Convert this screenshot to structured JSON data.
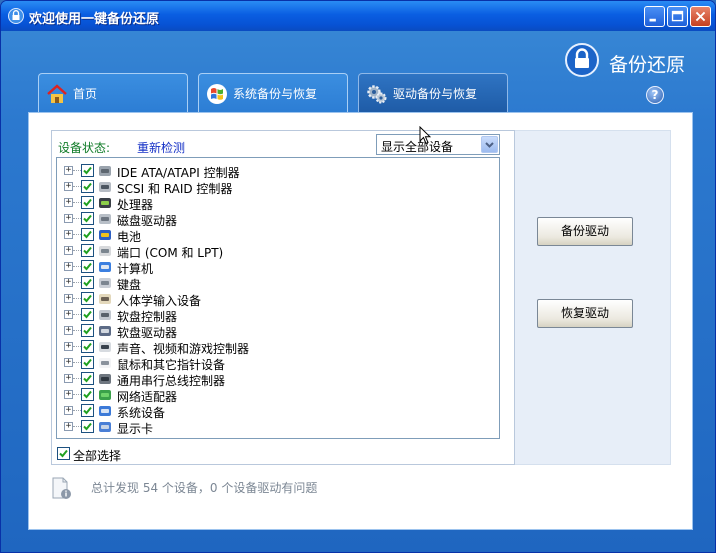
{
  "window": {
    "title": "欢迎使用一键备份还原"
  },
  "brand": {
    "label": "备份还原"
  },
  "tabs": [
    {
      "label": "首页",
      "icon": "home-icon"
    },
    {
      "label": "系统备份与恢复",
      "icon": "windows-logo-icon"
    },
    {
      "label": "驱动备份与恢复",
      "icon": "gears-icon",
      "active": true
    }
  ],
  "drivers": {
    "status_label": "设备状态:",
    "redetect_label": "重新检测",
    "filter": {
      "selected": "显示全部设备"
    },
    "devices": [
      {
        "label": "IDE ATA/ATAPI 控制器",
        "icon": "ide-controller-icon",
        "checked": true
      },
      {
        "label": "SCSI 和 RAID 控制器",
        "icon": "scsi-raid-icon",
        "checked": true
      },
      {
        "label": "处理器",
        "icon": "processor-icon",
        "checked": true
      },
      {
        "label": "磁盘驱动器",
        "icon": "disk-drive-icon",
        "checked": true
      },
      {
        "label": "电池",
        "icon": "battery-icon",
        "checked": true
      },
      {
        "label": "端口 (COM 和 LPT)",
        "icon": "port-icon",
        "checked": true
      },
      {
        "label": "计算机",
        "icon": "computer-icon",
        "checked": true
      },
      {
        "label": "键盘",
        "icon": "keyboard-icon",
        "checked": true
      },
      {
        "label": "人体学输入设备",
        "icon": "hid-icon",
        "checked": true
      },
      {
        "label": "软盘控制器",
        "icon": "floppy-controller-icon",
        "checked": true
      },
      {
        "label": "软盘驱动器",
        "icon": "floppy-drive-icon",
        "checked": true
      },
      {
        "label": "声音、视频和游戏控制器",
        "icon": "sound-icon",
        "checked": true
      },
      {
        "label": "鼠标和其它指针设备",
        "icon": "mouse-icon",
        "checked": true
      },
      {
        "label": "通用串行总线控制器",
        "icon": "usb-icon",
        "checked": true
      },
      {
        "label": "网络适配器",
        "icon": "network-adapter-icon",
        "checked": true
      },
      {
        "label": "系统设备",
        "icon": "system-device-icon",
        "checked": true
      },
      {
        "label": "显示卡",
        "icon": "display-adapter-icon",
        "checked": true
      }
    ],
    "select_all_label": "全部选择",
    "backup_button": "备份驱动",
    "restore_button": "恢复驱动",
    "summary": "总计发现 54 个设备，0 个设备驱动有问题"
  },
  "colors": {
    "titlebar": "#0a5ee2",
    "status_label": "#0f7b27",
    "link": "#1430c6"
  }
}
